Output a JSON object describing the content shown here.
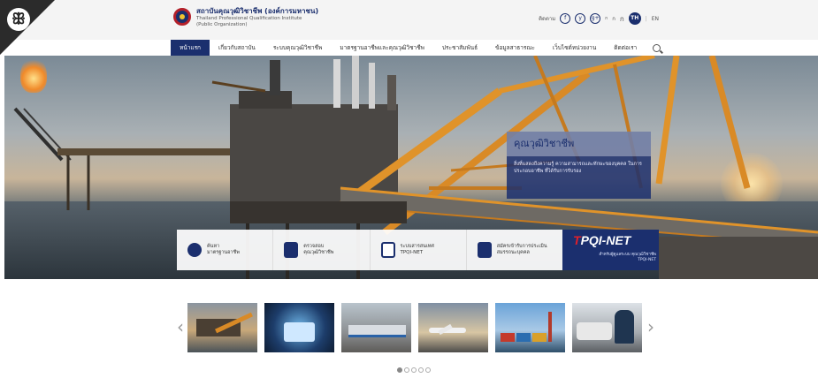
{
  "header": {
    "ribbon_mark": "ꕥ",
    "brand_th": "สถาบันคุณวุฒิวิชาชีพ (องค์การมหาชน)",
    "brand_en1": "Thailand Professional Qualification Institute",
    "brand_en2": "(Public Organization)",
    "follow_label": "ติดตาม",
    "social": [
      "f",
      "y",
      "g+"
    ],
    "font_sizes": [
      "ก",
      "ก",
      "ก"
    ],
    "lang_active": "TH",
    "lang_other": "EN"
  },
  "nav": {
    "items": [
      {
        "label": "หน้าแรก",
        "active": true
      },
      {
        "label": "เกี่ยวกับสถาบัน"
      },
      {
        "label": "ระบบคุณวุฒิวิชาชีพ"
      },
      {
        "label": "มาตรฐานอาชีพและคุณวุฒิวิชาชีพ"
      },
      {
        "label": "ประชาสัมพันธ์"
      },
      {
        "label": "ข้อมูลสาธารณะ"
      },
      {
        "label": "เว็บไซต์หน่วยงาน"
      },
      {
        "label": "ติดต่อเรา"
      }
    ]
  },
  "hero": {
    "card_title": "คุณวุฒิวิชาชีพ",
    "card_text": "สิ่งที่แสดงถึงความรู้ ความสามารถและทักษะของบุคคล ในการประกอบอาชีพ ที่ได้รับการรับรอง",
    "services": [
      {
        "label": "ค้นหา\nมาตรฐานอาชีพ",
        "icon": "search-people-icon"
      },
      {
        "label": "ตรวจสอบ\nคุณวุฒิวิชาชีพ",
        "icon": "person-check-icon"
      },
      {
        "label": "ระบบสารสนเทศ\nTPQI-NET",
        "icon": "document-icon"
      },
      {
        "label": "สมัครเข้ารับการประเมิน\nสมรรถนะบุคคล",
        "icon": "form-pen-icon"
      }
    ],
    "tpqi_logo": "TPQI-NET",
    "tpqi_sub": "สำหรับผู้ดูแลระบบ\nคุณวุฒิวิชาชีพ TPQI-NET"
  },
  "thumbnails": {
    "prev": "‹",
    "next": "›",
    "items": [
      "oil-rig",
      "business-tablet",
      "skytrain",
      "airport",
      "port-containers",
      "auto-mechanic"
    ],
    "dots": 5,
    "active_dot": 0
  },
  "colors": {
    "primary": "#1b2f6e",
    "accent": "#e0202a"
  }
}
